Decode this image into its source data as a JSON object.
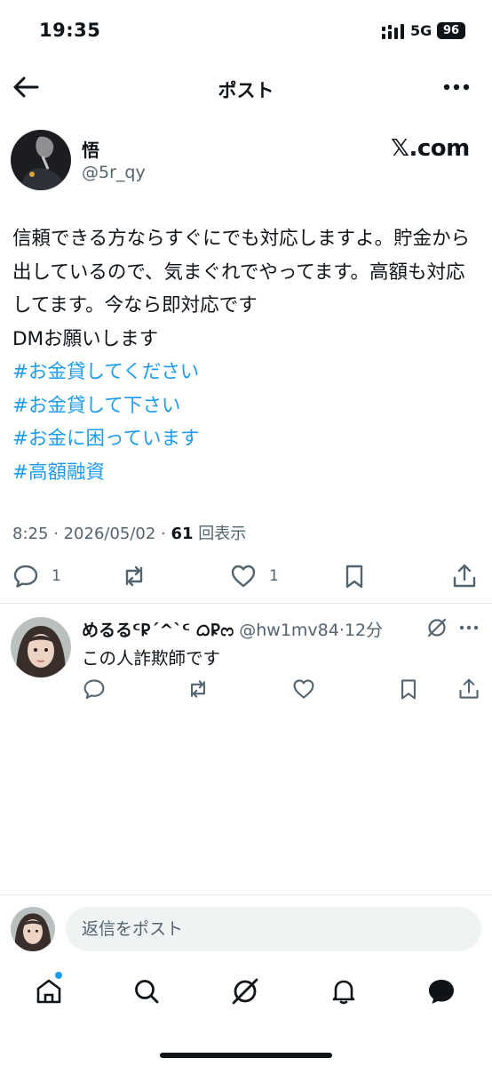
{
  "status_bar": {
    "time": "19:35",
    "network": "5G",
    "battery": "96",
    "icons": [
      "signal-icon",
      "battery-icon"
    ]
  },
  "header": {
    "title": "ポスト",
    "back_icon": "arrow-left-icon",
    "more_icon": "more-horizontal-icon"
  },
  "post": {
    "author_name": "悟",
    "author_handle": "@5r_qy",
    "source_label": "𝕏.com",
    "body_lines": [
      "信頼できる方ならすぐにでも対応しますよ。貯金から出しているので、気まぐれでやってます。高額も対応してます。今なら即対応です",
      "DMお願いします"
    ],
    "hashtags": [
      "#お金貸してください",
      "#お金貸して下さい",
      "#お金に困っています",
      "#高額融資"
    ],
    "timestamp": "8:25 · 2026/05/02 · ",
    "view_count": "61",
    "view_label": " 回表示",
    "actions": {
      "reply_count": "1",
      "like_count": "1"
    }
  },
  "reply": {
    "name": "めるるᑦ𐊯ˊ^ˋᑦ ᜊ𐊯ᦂ",
    "handle": "@hw1mv84",
    "time": "·12分",
    "text": "この人詐欺師です"
  },
  "compose": {
    "placeholder": "返信をポスト"
  },
  "tab_bar": {
    "tabs": [
      "home-icon",
      "search-icon",
      "grok-icon",
      "notifications-icon",
      "messages-icon"
    ]
  },
  "colors": {
    "accent": "#1d9bf0",
    "text": "#0f1419",
    "secondary": "#536471",
    "divider": "#e6e9ec"
  }
}
